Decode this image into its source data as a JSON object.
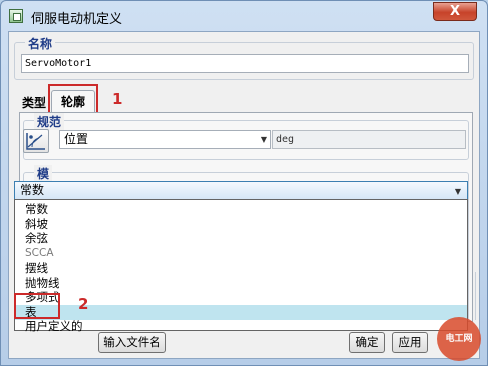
{
  "window": {
    "title": "伺服电动机定义",
    "close_symbol": "X"
  },
  "name_group": {
    "label": "名称",
    "value": "ServoMotor1"
  },
  "tabs": [
    {
      "label": "类型",
      "active": false
    },
    {
      "label": "轮廓",
      "active": true
    }
  ],
  "spec_group": {
    "label": "规范",
    "quantity_selected": "位置",
    "unit": "deg"
  },
  "model_group": {
    "label": "模",
    "selected": "常数",
    "options": [
      "常数",
      "斜坡",
      "余弦",
      "SCCA",
      "摆线",
      "抛物线",
      "多项式",
      "表",
      "用户定义的"
    ],
    "highlighted_option": "表"
  },
  "callouts": {
    "one": "1",
    "two": "2"
  },
  "buttons": {
    "import_file": "输入文件名",
    "ok": "确定",
    "apply": "应用"
  },
  "watermark": {
    "text": "电工网"
  },
  "colors": {
    "highlight_red": "#cc2a2a",
    "selection": "#bfe4ef",
    "title_blue": "#1f3c88"
  }
}
